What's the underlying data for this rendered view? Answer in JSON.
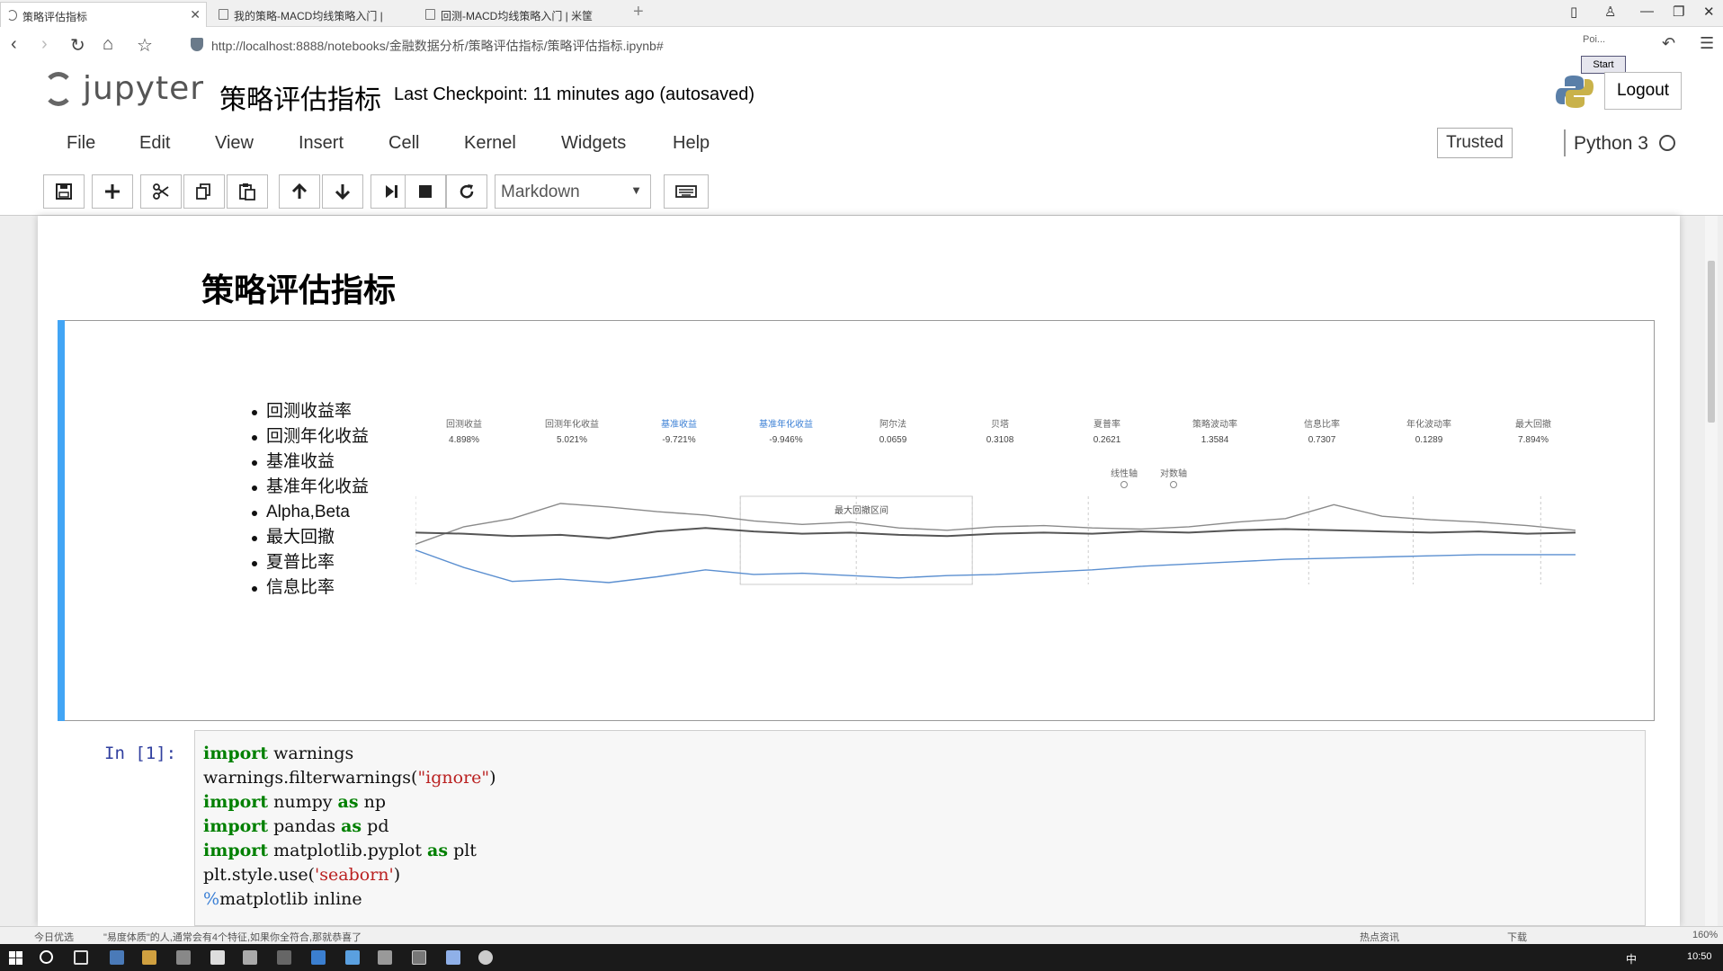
{
  "browser": {
    "tabs": [
      {
        "label": "策略评估指标",
        "active": true
      },
      {
        "label": "我的策略-MACD均线策略入门 |",
        "active": false
      },
      {
        "label": "回测-MACD均线策略入门 | 米筐",
        "active": false
      }
    ],
    "new_tab": "+",
    "url": "http://localhost:8888/notebooks/金融数据分析/策略评估指标/策略评估指标.ipynb#",
    "ext_poi": "Poi...",
    "ext_start": "Start"
  },
  "header": {
    "logo_text": "jupyter",
    "notebook_name": "策略评估指标",
    "checkpoint": "Last Checkpoint: 11 minutes ago (autosaved)",
    "logout": "Logout"
  },
  "menu": {
    "items": [
      "File",
      "Edit",
      "View",
      "Insert",
      "Cell",
      "Kernel",
      "Widgets",
      "Help"
    ],
    "trusted": "Trusted",
    "kernel": "Python 3"
  },
  "toolbar": {
    "buttons": [
      "save-icon",
      "plus-icon",
      "cut-icon",
      "copy-icon",
      "paste-icon",
      "arrow-up-icon",
      "arrow-down-icon",
      "run-icon",
      "stop-icon",
      "restart-icon"
    ],
    "cell_type": "Markdown",
    "keyboard": "keyboard-icon"
  },
  "markdown": {
    "heading": "策略评估指标",
    "bullets": [
      "回测收益率",
      "回测年化收益",
      "基准收益",
      "基准年化收益",
      "Alpha,Beta",
      "最大回撤",
      "夏普比率",
      "信息比率"
    ]
  },
  "metrics": [
    {
      "label": "回测收益",
      "value": "4.898%",
      "highlight": false
    },
    {
      "label": "回测年化收益",
      "value": "5.021%",
      "highlight": false
    },
    {
      "label": "基准收益",
      "value": "-9.721%",
      "highlight": true
    },
    {
      "label": "基准年化收益",
      "value": "-9.946%",
      "highlight": true
    },
    {
      "label": "阿尔法",
      "value": "0.0659",
      "highlight": false
    },
    {
      "label": "贝塔",
      "value": "0.3108",
      "highlight": false
    },
    {
      "label": "夏普率",
      "value": "0.2621",
      "highlight": false
    },
    {
      "label": "策略波动率",
      "value": "1.3584",
      "highlight": false
    },
    {
      "label": "信息比率",
      "value": "0.7307",
      "highlight": false
    },
    {
      "label": "年化波动率",
      "value": "0.1289",
      "highlight": false
    },
    {
      "label": "最大回撤",
      "value": "7.894%",
      "highlight": false
    }
  ],
  "chart_data": {
    "type": "line",
    "annotation": "最大回撤区间",
    "axis_toggles": [
      "线性轴",
      "对数轴"
    ],
    "series": [
      {
        "color": "#8a8a8a",
        "values": [
          -1,
          0.5,
          1.2,
          2.5,
          2.2,
          1.8,
          1.5,
          1.0,
          0.7,
          0.9,
          0.4,
          0.2,
          0.5,
          0.6,
          0.4,
          0.3,
          0.5,
          0.9,
          1.2,
          2.4,
          1.4,
          1.1,
          0.9,
          0.6,
          0.2
        ]
      },
      {
        "color": "#555555",
        "values": [
          0,
          -0.1,
          -0.3,
          -0.2,
          -0.5,
          0.1,
          0.4,
          0.1,
          -0.1,
          0.0,
          -0.2,
          -0.3,
          -0.1,
          0.0,
          -0.1,
          0.1,
          0.0,
          0.2,
          0.3,
          0.2,
          0.1,
          0.0,
          0.1,
          -0.1,
          0.0
        ]
      },
      {
        "color": "#5b8fd0",
        "values": [
          -1.5,
          -3.0,
          -4.2,
          -4.0,
          -4.3,
          -3.8,
          -3.2,
          -3.6,
          -3.5,
          -3.7,
          -3.9,
          -3.7,
          -3.6,
          -3.4,
          -3.2,
          -2.9,
          -2.7,
          -2.5,
          -2.3,
          -2.2,
          -2.1,
          -2.0,
          -1.9,
          -1.9,
          -1.9
        ]
      }
    ]
  },
  "code_cell": {
    "prompt": "In  [1]:",
    "lines": [
      "import warnings",
      "warnings.filterwarnings(\"ignore\")",
      "import numpy as np",
      "import pandas as pd",
      "import matplotlib.pyplot as plt",
      "plt.style.use('seaborn')",
      "%matplotlib inline"
    ]
  },
  "statusbar": {
    "left": "今日优选",
    "news": "\"易度体质\"的人,通常会有4个特征,如果你全符合,那就恭喜了",
    "hot": "热点资讯",
    "download": "下载",
    "zoom": "160%"
  },
  "taskbar": {
    "ime": "中",
    "clock": "10:50"
  }
}
